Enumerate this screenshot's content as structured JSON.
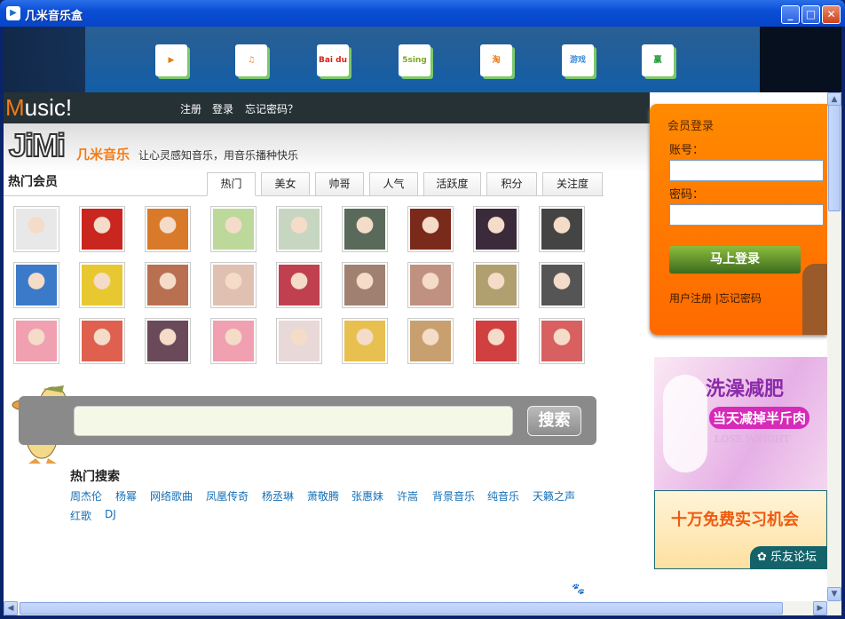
{
  "window": {
    "title": "几米音乐盒",
    "minimize": "_",
    "maximize": "□",
    "close": "✕"
  },
  "banner": {
    "apps": [
      {
        "name": "youku",
        "label": "▶"
      },
      {
        "name": "music",
        "label": "♫"
      },
      {
        "name": "baidu-radio",
        "label": "Bai du"
      },
      {
        "name": "5sing",
        "label": "5sing"
      },
      {
        "name": "taobao",
        "label": "淘"
      },
      {
        "name": "games",
        "label": "游戏"
      },
      {
        "name": "lottery",
        "label": "赢"
      }
    ]
  },
  "header": {
    "logo_first": "M",
    "logo_rest": "usic!",
    "links": [
      "注册",
      "登录",
      "忘记密码？"
    ]
  },
  "brand": {
    "logo": "JiMi",
    "logo_cn": "几米音乐",
    "slogan": "让心灵感知音乐，用音乐播种快乐"
  },
  "members": {
    "title": "热门会员",
    "tabs": [
      "热门",
      "美女",
      "帅哥",
      "人气",
      "活跃度",
      "积分",
      "关注度"
    ],
    "active_tab": 0,
    "avatar_colors": [
      "#e8e8e8",
      "#c8261e",
      "#d97a2a",
      "#bcd89a",
      "#c6d6c0",
      "#5a6a5a",
      "#7a2a1a",
      "#3a2a3a",
      "#444444",
      "#3a7ac8",
      "#e8c830",
      "#b87050",
      "#e0c0b0",
      "#c04050",
      "#a08070",
      "#c09080",
      "#b0a070",
      "#555555",
      "#f0a0b0",
      "#e06050",
      "#6a4a5a",
      "#f0a0b0",
      "#e8d8d8",
      "#e8c050",
      "#c8a070",
      "#d04040",
      "#d86060"
    ]
  },
  "search": {
    "value": "",
    "button": "搜索"
  },
  "hot_search": {
    "title": "热门搜索",
    "terms": [
      "周杰伦",
      "杨幂",
      "网络歌曲",
      "凤凰传奇",
      "杨丞琳",
      "萧敬腾",
      "张惠妹",
      "许嵩",
      "背景音乐",
      "纯音乐",
      "天籁之声",
      "红歌",
      "DJ"
    ]
  },
  "login": {
    "title": "会员登录",
    "account_label": "账号：",
    "password_label": "密码：",
    "account_value": "",
    "password_value": "",
    "button": "马上登录",
    "register": "用户注册",
    "separator": "|",
    "forgot": "忘记密码"
  },
  "ads": {
    "ad1_title": "洗澡减肥",
    "ad1_sub": "当天减掉半斤肉",
    "ad1_en": "LOSE WEIGHT",
    "ad2_title": "十万免费实习机会",
    "ad2_brand": "乐友论坛"
  }
}
